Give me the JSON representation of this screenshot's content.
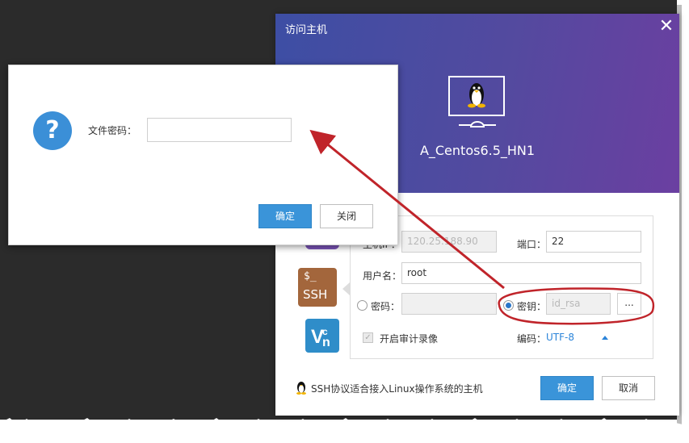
{
  "main_dialog": {
    "title": "访问主机",
    "close_glyph": "✕",
    "host_name": "A_Centos6.5_HN1",
    "protocols": [
      {
        "name": "rdp",
        "label": ""
      },
      {
        "name": "ssh",
        "prompt": "$_",
        "label": "SSH"
      },
      {
        "name": "vnc",
        "label": "VN"
      }
    ],
    "form": {
      "ip_label": "主机IP：",
      "ip_value": "120.25.188.90",
      "port_label": "端口：",
      "port_value": "22",
      "username_label": "用户名：",
      "username_value": "root",
      "password_label": "密码：",
      "password_value": "",
      "key_label": "密钥：",
      "key_value": "id_rsa",
      "browse_label": "...",
      "audit_label": "开启审计录像",
      "encoding_label": "编码：",
      "encoding_value": "UTF-8",
      "auth_selected": "key",
      "audit_checked": true
    },
    "footer_note": "SSH协议适合接入Linux操作系统的主机",
    "ok_label": "确定",
    "cancel_label": "取消"
  },
  "prompt_dialog": {
    "icon": "question-icon",
    "field_label": "文件密码：",
    "field_value": "",
    "ok_label": "确定",
    "close_label": "关闭"
  },
  "colors": {
    "header_start": "#3d4ea4",
    "header_end": "#6b3fa1",
    "primary_button": "#3a94d9",
    "annotation": "#c0242a",
    "ssh_tab": "#a3663c",
    "vnc_tab": "#2f8dc9"
  }
}
